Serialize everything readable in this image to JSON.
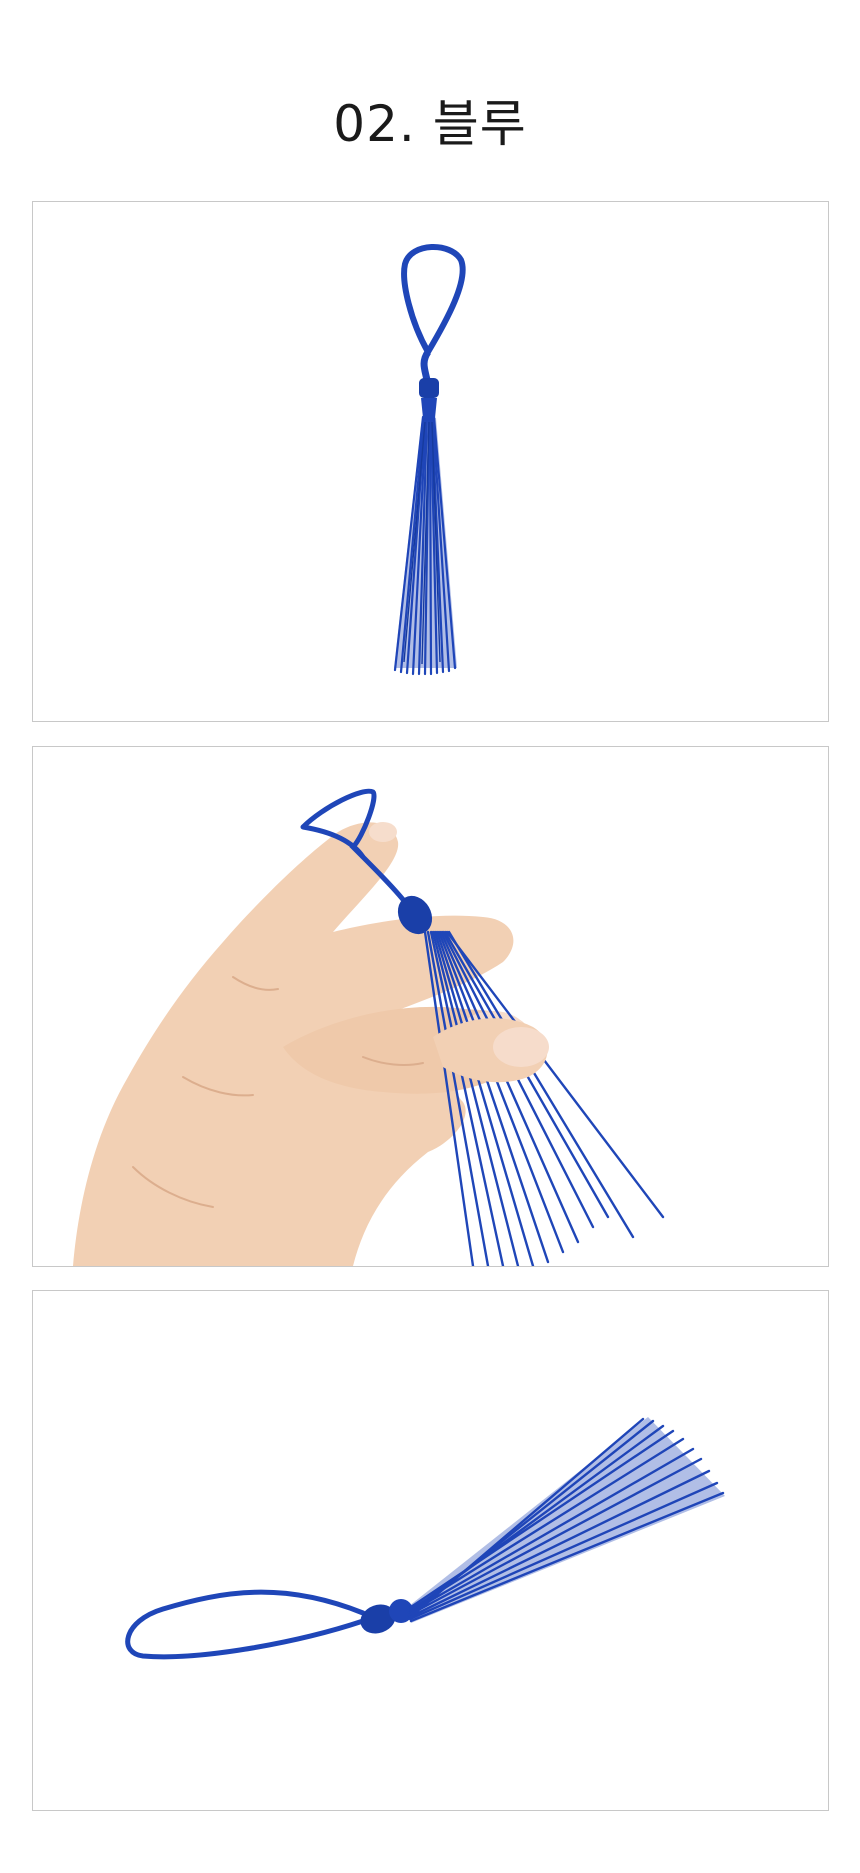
{
  "page": {
    "title": "02. 블루"
  },
  "colors": {
    "tassel": "#1f46b8",
    "tassel_dark": "#123590",
    "tassel_light": "#3a63d4",
    "skin": "#f2d0b4",
    "skin_shadow": "#dcae8e",
    "frame_border": "#c8c8c8"
  },
  "photos": [
    {
      "subject": "tassel-hanging-photo"
    },
    {
      "subject": "hand-holding-tassel-photo"
    },
    {
      "subject": "tassel-lying-photo"
    }
  ]
}
